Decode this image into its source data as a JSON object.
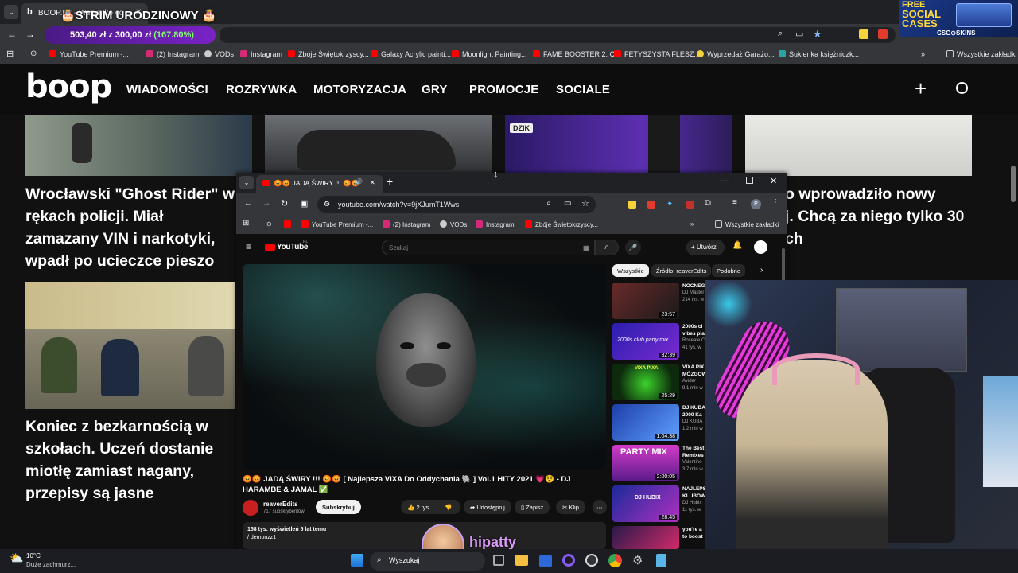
{
  "outer_browser": {
    "tab_title": "BOOP.PL - Wszystko co fajne",
    "stream_title": "🎂STRIM URODZINOWY 🎂",
    "donation_goal": "503,40 zł z 300,00 zł",
    "donation_percent": "(167.80%)",
    "bookmarks": [
      "YouTube Premium -...",
      "(2) Instagram",
      "VODs",
      "Instagram",
      "Zbóje Świętokrzyscy...",
      "Galaxy Acrylic painti...",
      "Moonlight Painting...",
      "FAME BOOSTER 2: C...",
      "FETYSZYSTA FLESZ...",
      "Wyprzedaż Garażo...",
      "Sukienka księżniczk..."
    ],
    "all_bookmarks": "Wszystkie zakładki"
  },
  "ad": {
    "line1": "FREE",
    "line2": "SOCIAL",
    "line3": "CASES",
    "brand": "CSG⊙SKINS"
  },
  "site": {
    "logo": "boop",
    "nav": [
      "WIADOMOŚCI",
      "ROZRYWKA",
      "MOTORYZACJA",
      "GRY",
      "PROMOCJE",
      "SOCIALE"
    ],
    "headline_1": "Wrocławski \"Ghost Rider\" w rękach policji. Miał zamazany VIN i narkotyki, wpadł po ucieczce pieszo",
    "headline_2": "Koniec z bezkarnością w szkołach. Uczeń dostanie miotłę zamiast nagany, przepisy są jasne",
    "headline_3_fragment": "o wprowadziło nowy\nj. Chcą za niego tylko 30\nch",
    "thumb_label": "DZIK"
  },
  "inner_browser": {
    "tab_title": "😡😡 JADĄ ŚWIRY !!! 😡😡",
    "url": "youtube.com/watch?v=9jXJumT1Wws",
    "bookmarks": [
      "YouTube Premium -...",
      "(2) Instagram",
      "VODs",
      "Instagram",
      "Zbóje Świętokrzyscy..."
    ],
    "all_bookmarks": "Wszystkie zakładki"
  },
  "youtube": {
    "logo": "YouTube",
    "region": "PL",
    "search_placeholder": "Szukaj",
    "create": "Utwórz",
    "video_title": "😡😡 JADĄ ŚWIRY !!! 😡😡 [ Najlepsza VIXA Do Oddychania 🐘 ] Vol.1 HITY 2021 💗😵 - DJ HARAMBE & JAMAL ✅",
    "channel": "reaverEdits",
    "subscribers": "717 subskrybentów",
    "subscribe": "Subskrybuj",
    "likes": "2 tys.",
    "share": "Udostępnij",
    "save": "Zapisz",
    "clip": "Klip",
    "views": "158 tys. wyświetleń  5 lat temu",
    "desc_line": "/ demonzz1",
    "chips": [
      "Wszystkie",
      "Źródło: reaverEdits",
      "Podobne"
    ],
    "recommendations": [
      {
        "title": "NOCNEG",
        "meta": "DJ Master\n214 tys. w",
        "duration": "23:57"
      },
      {
        "title": "2000s cl\nvibes pla",
        "meta": "Roseate C\n41 tys. w",
        "duration": "32:39"
      },
      {
        "title": "VIXA PIX\nMÓZGOW",
        "meta": "Avider\n9,1 mln w",
        "duration": "25:29"
      },
      {
        "title": "DJ KUBA\n2000 Ka",
        "meta": "DJ KUBA\n1,2 mln w",
        "duration": "1:04:38"
      },
      {
        "title": "The Best\nRemixes",
        "meta": "Valentino\n3,7 mln w",
        "duration": "2:00:05"
      },
      {
        "title": "NAJLEPS\nKLUBOW",
        "meta": "DJ Hubix\n11 tys. w",
        "duration": "28:45"
      },
      {
        "title": "you're a\nto boost",
        "meta": "",
        "duration": ""
      }
    ],
    "rec_labels": [
      "2000s club party mix",
      "VIXA PIXA",
      "PARTY MIX",
      "DJ HUBIX"
    ]
  },
  "overlay": {
    "streamer_name": "hipatty"
  },
  "taskbar": {
    "temp": "10°C",
    "weather": "Duże zachmurz...",
    "search": "Wyszukaj"
  },
  "colors": {
    "accent_purple": "#6a1fb0",
    "yt_red": "#ff0000",
    "donation_green": "#7fff6a"
  }
}
